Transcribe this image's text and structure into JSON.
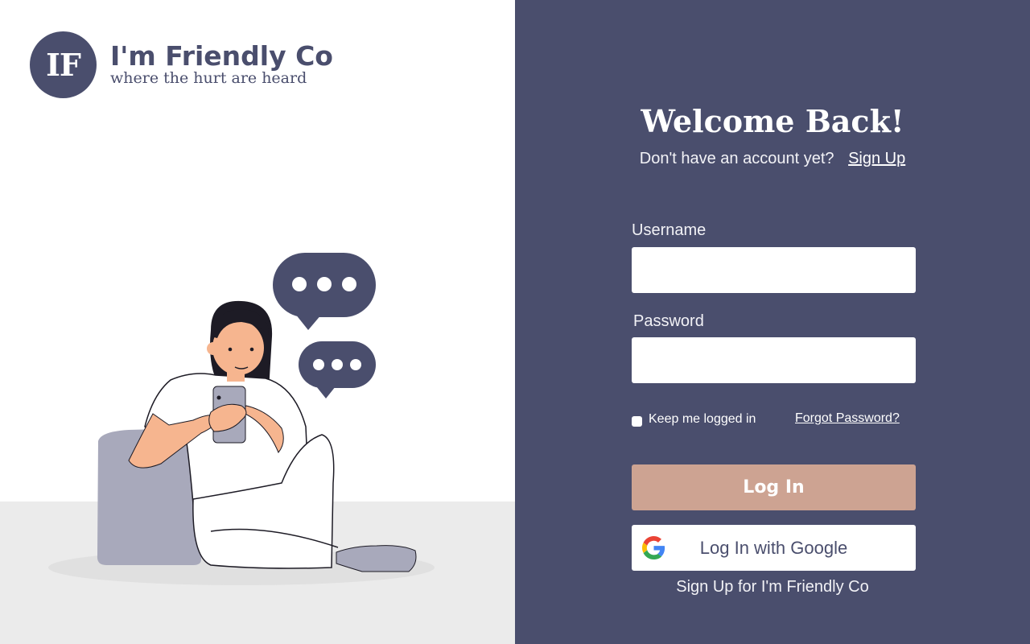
{
  "brand": {
    "logo_initials": "IF",
    "name": "I'm Friendly Co",
    "tagline": "where the hurt are heard"
  },
  "login": {
    "title": "Welcome Back!",
    "no_account_text": "Don't have an account yet?",
    "signup_link": "Sign Up",
    "username_label": "Username",
    "username_value": "",
    "password_label": "Password",
    "password_value": "",
    "keep_logged_in_label": "Keep me logged in",
    "keep_logged_in_checked": false,
    "forgot_password_link": "Forgot Password?",
    "login_button": "Log In",
    "google_button": "Log In with Google",
    "google_icon": "google-g-icon",
    "footer_signup_link": "Sign Up for I'm Friendly Co"
  },
  "illustration": {
    "subject": "woman-on-phone-icon",
    "bubbles": [
      "chat-bubble-icon",
      "chat-bubble-icon"
    ]
  },
  "colors": {
    "brand_navy": "#4a4e6d",
    "login_button": "#cda392",
    "floor": "#ebebeb",
    "cushion": "#a8a9bb",
    "skin": "#f6b58f"
  }
}
